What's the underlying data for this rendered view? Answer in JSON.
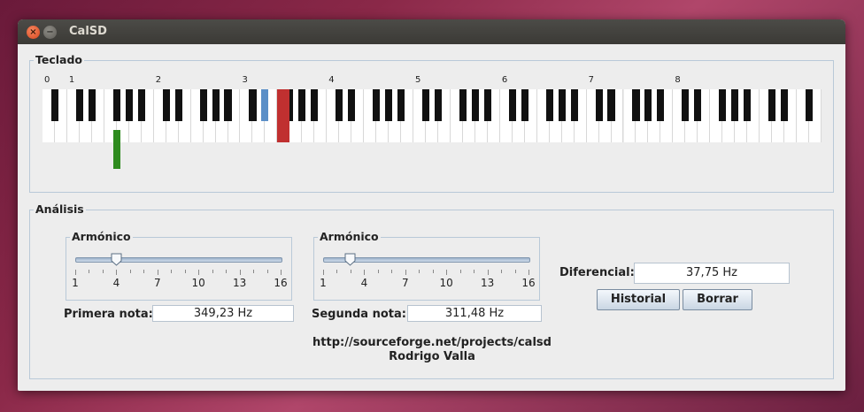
{
  "window": {
    "title": "CalSD"
  },
  "keyboard_group": {
    "legend": "Teclado",
    "octave_labels": [
      "0",
      "1",
      "2",
      "3",
      "4",
      "5",
      "6",
      "7",
      "8"
    ],
    "markers": {
      "primary": {
        "color": "#c03030",
        "key": "F3"
      },
      "secondary": {
        "color": "#5b8fc7",
        "key": "D#3"
      },
      "fundamental": {
        "color": "#2e8b1e",
        "key": "F#1"
      }
    }
  },
  "analysis_group": {
    "legend": "Análisis",
    "slider1": {
      "legend": "Armónico",
      "min": 1,
      "max": 16,
      "value": 4,
      "ticks": [
        "1",
        "4",
        "7",
        "10",
        "13",
        "16"
      ]
    },
    "slider2": {
      "legend": "Armónico",
      "min": 1,
      "max": 16,
      "value": 3,
      "ticks": [
        "1",
        "4",
        "7",
        "10",
        "13",
        "16"
      ]
    },
    "first_note": {
      "label": "Primera nota:",
      "value": "349,23 Hz"
    },
    "second_note": {
      "label": "Segunda nota:",
      "value": "311,48 Hz"
    },
    "differential": {
      "label": "Diferencial:",
      "value": "37,75 Hz"
    },
    "buttons": {
      "history": "Historial",
      "clear": "Borrar"
    },
    "credits": {
      "url": "http://sourceforge.net/projects/calsd",
      "author": "Rodrigo Valla"
    }
  }
}
